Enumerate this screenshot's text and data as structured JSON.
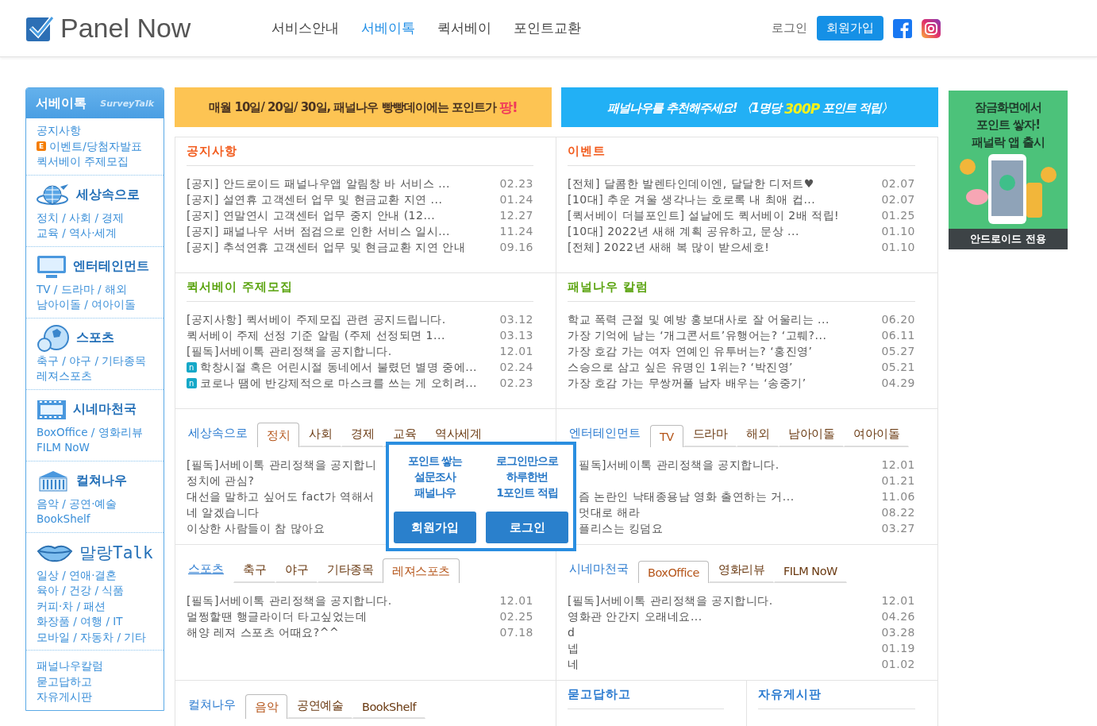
{
  "header": {
    "logo": "Panel Now",
    "nav": [
      {
        "label": "서비스안내",
        "selected": false
      },
      {
        "label": "서베이톡",
        "selected": true
      },
      {
        "label": "퀵서베이",
        "selected": false
      },
      {
        "label": "포인트교환",
        "selected": false
      }
    ],
    "login": "로그인",
    "signup": "회원가입"
  },
  "sidebar": {
    "title": "서베이톡",
    "subtitle": "SurveyTalk",
    "top_links": [
      {
        "label": "공지사항"
      },
      {
        "label": "이벤트/당첨자발표",
        "badge": "E"
      },
      {
        "label": "퀵서베이 주제모집"
      }
    ],
    "sections": [
      {
        "title": "세상속으로",
        "lines": [
          "정치 / 사회 / 경제",
          "교육 / 역사·세계"
        ]
      },
      {
        "title": "엔터테인먼트",
        "lines": [
          "TV / 드라마 / 해외",
          "남아이돌 / 여아이돌"
        ]
      },
      {
        "title": "스포츠",
        "lines": [
          "축구 / 야구 / 기타종목",
          "레져스포츠"
        ]
      },
      {
        "title": "시네마천국",
        "lines": [
          "BoxOffice / 영화리뷰",
          "FILM NoW"
        ]
      },
      {
        "title": "컬쳐나우",
        "lines": [
          "음악 / 공연·예술",
          "BookShelf"
        ]
      },
      {
        "title": "말랑Talk",
        "lines": [
          "일상 / 연애·결혼",
          "육아 / 건강 / 식품",
          "커피·차 / 패션",
          "화장품 / 여행 / IT",
          "모바일 / 자동차 / 기타"
        ]
      }
    ],
    "bottom_links": [
      "패널나우칼럼",
      "묻고답하고",
      "자유게시판"
    ]
  },
  "banners": [
    {
      "kind": "yellow",
      "parts": [
        {
          "text": "매월 10일/ 20일/ 30일, 패널나우 **빵빵데이**에는 포인트가",
          "accent": false
        },
        {
          "text": "팡!",
          "accent": true
        }
      ]
    },
    {
      "kind": "blue",
      "parts": [
        {
          "text": "패널나우를 추천해주세요! 〈1명당",
          "accent": false
        },
        {
          "text": "300P",
          "accent": true
        },
        {
          "text": "포인트 적립〉",
          "accent": false
        }
      ]
    }
  ],
  "panel_rows": [
    [
      {
        "kind": "list",
        "title": "공지사항",
        "color": "#f25c1e",
        "rows": [
          {
            "title": "[공지] 안드로이드 패널나우앱 알림창 바 서비스 ...",
            "date": "02.23"
          },
          {
            "title": "[공지] 설연휴 고객센터 업무 및 현금교환 지연 ...",
            "date": "01.24"
          },
          {
            "title": "[공지] 연말연시 고객센터 업무 중지 안내 (12...",
            "date": "12.27"
          },
          {
            "title": "[공지] 패널나우 서버 점검으로 인한 서비스 일시...",
            "date": "11.24"
          },
          {
            "title": "[공지] 추석연휴 고객센터 업무 및 현금교환 지연 안내",
            "date": "09.16"
          }
        ]
      },
      {
        "kind": "list",
        "title": "이벤트",
        "color": "#f25c1e",
        "rows": [
          {
            "title": "[전체] 달콤한 발렌타인데이엔, 달달한 디저트♥",
            "date": "02.07"
          },
          {
            "title": "[10대] 추운 겨울 생각나는 호로록 내 최애 컵...",
            "date": "02.07"
          },
          {
            "title": "[퀵서베이 더블포인트] 설날에도 퀵서베이 2배 적립!",
            "date": "01.25"
          },
          {
            "title": "[10대] 2022년 새해 계획 공유하고, 문상 ...",
            "date": "01.10"
          },
          {
            "title": "[전체] 2022년 새해 복 많이 받으세호!",
            "date": "01.10"
          }
        ]
      }
    ],
    [
      {
        "kind": "list",
        "title": "퀵서베이 주제모집",
        "color": "#5aa30f",
        "rows": [
          {
            "title": "[공지사항] 퀵서베이 주제모집 관련 공지드립니다.",
            "date": "03.12"
          },
          {
            "title": "퀵서베이 주제 선정 기준 알림 (주제 선정되면 1...",
            "date": "03.13"
          },
          {
            "title": "[필독]서베이톡 관리정책을 공지합니다.",
            "date": "12.01"
          },
          {
            "title": "학창시절 혹은 어린시절 동네에서 불렸던 별명 중에...",
            "date": "02.24",
            "badge": "n"
          },
          {
            "title": "코로나 땜에 반강제적으로 마스크를 쓰는 게 오히려...",
            "date": "02.23",
            "badge": "n"
          }
        ]
      },
      {
        "kind": "list",
        "title": "패널나우 칼럼",
        "color": "#5aa30f",
        "rows": [
          {
            "title": "학교 폭력 근절 및 예방 홍보대사로 잘 어울리는 ...",
            "date": "06.20"
          },
          {
            "title": "가장 기억에 남는 ‘개그콘서트’유행어는? ‘고뤠?...",
            "date": "06.11"
          },
          {
            "title": "가장 호감 가는 여자 연예인 유투버는? ‘홍진영’",
            "date": "05.27"
          },
          {
            "title": "스승으로 삼고 싶은 유명인 1위는? ‘박진영’",
            "date": "05.21"
          },
          {
            "title": "가장 호감 가는 무쌍꺼풀 남자 배우는 ‘송중기’",
            "date": "04.29"
          }
        ]
      }
    ],
    [
      {
        "kind": "tabs",
        "title": "세상속으로",
        "tabs": [
          {
            "label": "정치",
            "selected": true
          },
          {
            "label": "사회",
            "selected": false
          },
          {
            "label": "경제",
            "selected": false
          },
          {
            "label": "교육",
            "selected": false
          },
          {
            "label": "역사세계",
            "selected": false
          }
        ],
        "rows": [
          {
            "title": "[필독]서베이톡 관리정책을 공지합니"
          },
          {
            "title": "정치에 관심?"
          },
          {
            "title": "대선을 말하고 싶어도 fact가 역해서"
          },
          {
            "title": "네 알겠습니다"
          },
          {
            "title": "이상한 사람들이 참 많아요"
          }
        ]
      },
      {
        "kind": "tabs",
        "title": "엔터테인먼트",
        "covered": true,
        "tabs": [
          {
            "label": "TV",
            "selected": true
          },
          {
            "label": "드라마",
            "selected": false
          },
          {
            "label": "해외",
            "selected": false
          },
          {
            "label": "남아이돌",
            "selected": false
          },
          {
            "label": "여아이돌",
            "selected": false
          }
        ],
        "rows": [
          {
            "title": "필독]서베이톡 관리정책을 공지합니다.",
            "date": "12.01"
          },
          {
            "date": "01.21"
          },
          {
            "title": "즘 논란인 낙태종용남 영화 출연하는 거...",
            "date": "11.06"
          },
          {
            "title": "멋대로 해라",
            "date": "08.22"
          },
          {
            "title": "플리스는 킹덤요",
            "date": "03.27"
          }
        ]
      }
    ],
    [
      {
        "kind": "tabs",
        "title": "스포츠",
        "underline": true,
        "tabs": [
          {
            "label": "축구",
            "selected": false
          },
          {
            "label": "야구",
            "selected": false
          },
          {
            "label": "기타종목",
            "selected": false
          },
          {
            "label": "레져스포츠",
            "selected": true
          }
        ],
        "rows": [
          {
            "title": "[필독]서베이톡 관리정책을 공지합니다.",
            "date": "12.01"
          },
          {
            "title": "멀쩡할땐 행글라이더 타고싶었는데",
            "date": "02.25"
          },
          {
            "title": "해양 레져 스포츠 어때요?^^",
            "date": "07.18"
          }
        ]
      },
      {
        "kind": "tabs",
        "title": "시네마천국",
        "tabs": [
          {
            "label": "BoxOffice",
            "selected": true
          },
          {
            "label": "영화리뷰",
            "selected": false
          },
          {
            "label": "FILM NoW",
            "selected": false
          }
        ],
        "rows": [
          {
            "title": "[필독]서베이톡 관리정책을 공지합니다.",
            "date": "12.01"
          },
          {
            "title": "영화관 안간지 오래네요...",
            "date": "04.26"
          },
          {
            "title": "d",
            "date": "03.28"
          },
          {
            "title": "넵",
            "date": "01.19"
          },
          {
            "title": "네",
            "date": "01.02"
          }
        ]
      }
    ],
    [
      {
        "kind": "tabs",
        "title": "컬쳐나우",
        "tabs": [
          {
            "label": "음악",
            "selected": true
          },
          {
            "label": "공연예술",
            "selected": false
          },
          {
            "label": "BookShelf",
            "selected": false
          }
        ]
      },
      {
        "kind": "heading",
        "title": "묻고답하고"
      },
      {
        "kind": "heading",
        "title": "자유게시판"
      }
    ]
  ],
  "popup": {
    "columns": [
      {
        "lines": [
          "포인트 쌓는",
          "설문조사",
          "패널나우"
        ],
        "button": "회원가입"
      },
      {
        "lines": [
          "로그인만으로",
          "하루한번",
          "1포인트 적립"
        ],
        "button": "로그인"
      }
    ]
  },
  "ad": {
    "lines": [
      "잠금화면에서",
      "포인트 쌓자!",
      "패널락 앱 출시"
    ],
    "footer": "안드로이드 전용"
  }
}
